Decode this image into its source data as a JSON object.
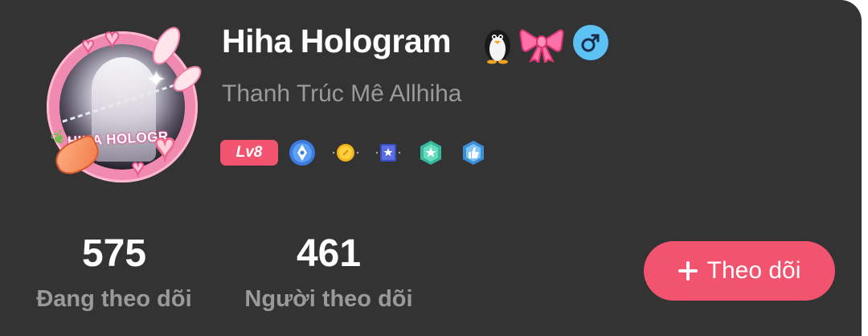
{
  "profile": {
    "display_name": "Hiha Hologram",
    "username": "Thanh Trúc Mê Allhiha",
    "avatar_text": "HIHA HOLOGR",
    "name_emojis": [
      "penguin-icon",
      "pink-bow-icon"
    ],
    "gender_icon": "male-icon",
    "gender_symbol": "♂",
    "level": "Lv8",
    "badges": [
      "pen-badge-icon",
      "sun-badge-icon",
      "star-card-badge-icon",
      "star-shield-badge-icon",
      "thumbs-up-badge-icon"
    ]
  },
  "stats": {
    "following_count": "575",
    "following_label": "Đang theo dõi",
    "followers_count": "461",
    "followers_label": "Người theo dõi"
  },
  "actions": {
    "follow_label": "Theo dõi"
  },
  "colors": {
    "background": "#333333",
    "accent": "#f2536e",
    "muted_text": "#9a9a9a",
    "gender_badge": "#5cc1f3",
    "avatar_frame": "#f08ab0"
  }
}
